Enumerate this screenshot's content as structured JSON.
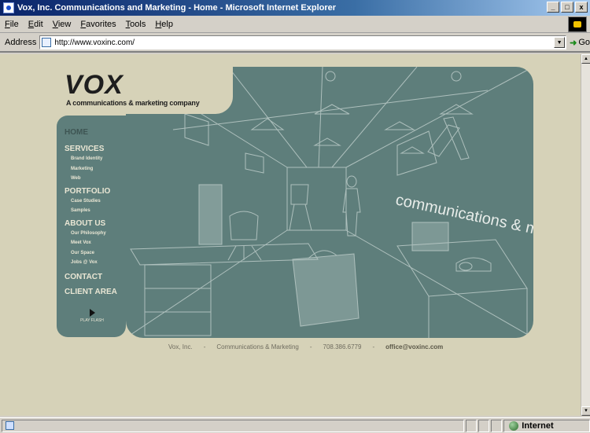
{
  "window": {
    "title": "Vox, Inc. Communications and Marketing - Home - Microsoft Internet Explorer",
    "minimize": "_",
    "maximize": "□",
    "close": "x"
  },
  "menu": [
    "File",
    "Edit",
    "View",
    "Favorites",
    "Tools",
    "Help"
  ],
  "address": {
    "label": "Address",
    "url": "http://www.voxinc.com/",
    "go_label": "Go"
  },
  "site": {
    "logo": "VOX",
    "tagline": "A communications & marketing company",
    "hero_text": "communications & marketing company",
    "nav": {
      "home": "HOME",
      "services": "SERVICES",
      "services_items": [
        "Brand Identity",
        "Marketing",
        "Web"
      ],
      "portfolio": "PORTFOLIO",
      "portfolio_items": [
        "Case Studies",
        "Samples"
      ],
      "about": "ABOUT US",
      "about_items": [
        "Our Philosophy",
        "Meet Vox",
        "Our Space",
        "Jobs @ Vox"
      ],
      "contact": "CONTACT",
      "client": "CLIENT AREA",
      "play_label": "PLAY FLASH"
    },
    "footer": {
      "company": "Vox, Inc.",
      "sep": "-",
      "service": "Communications & Marketing",
      "phone": "708.386.6779",
      "email": "office@voxinc.com"
    }
  },
  "status": {
    "zone": "Internet"
  }
}
